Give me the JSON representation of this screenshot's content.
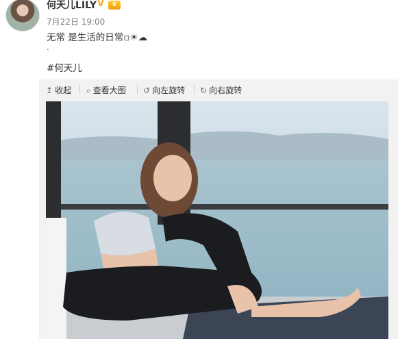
{
  "post": {
    "username": "何天儿LILY",
    "verified_icon": "verified-v-icon",
    "vip_icon": "vip-badge-icon",
    "timestamp": "7月22日 19:00",
    "text": "无常 是生活的日常▫☀☁",
    "dot": ".",
    "hashtag": "#何天儿"
  },
  "toolbar": {
    "collapse": {
      "icon": "↥",
      "label": "收起"
    },
    "view_large": {
      "icon": "🔍",
      "label": "查看大图"
    },
    "rotate_left": {
      "icon": "↺",
      "label": "向左旋转"
    },
    "rotate_right": {
      "icon": "↻",
      "label": "向右旋转"
    }
  },
  "photo": {
    "description_icon": "photo"
  },
  "colors": {
    "toolbar_bg": "#f2f2f2",
    "text": "#333333",
    "meta": "#808080",
    "verified": "#f5a623"
  }
}
